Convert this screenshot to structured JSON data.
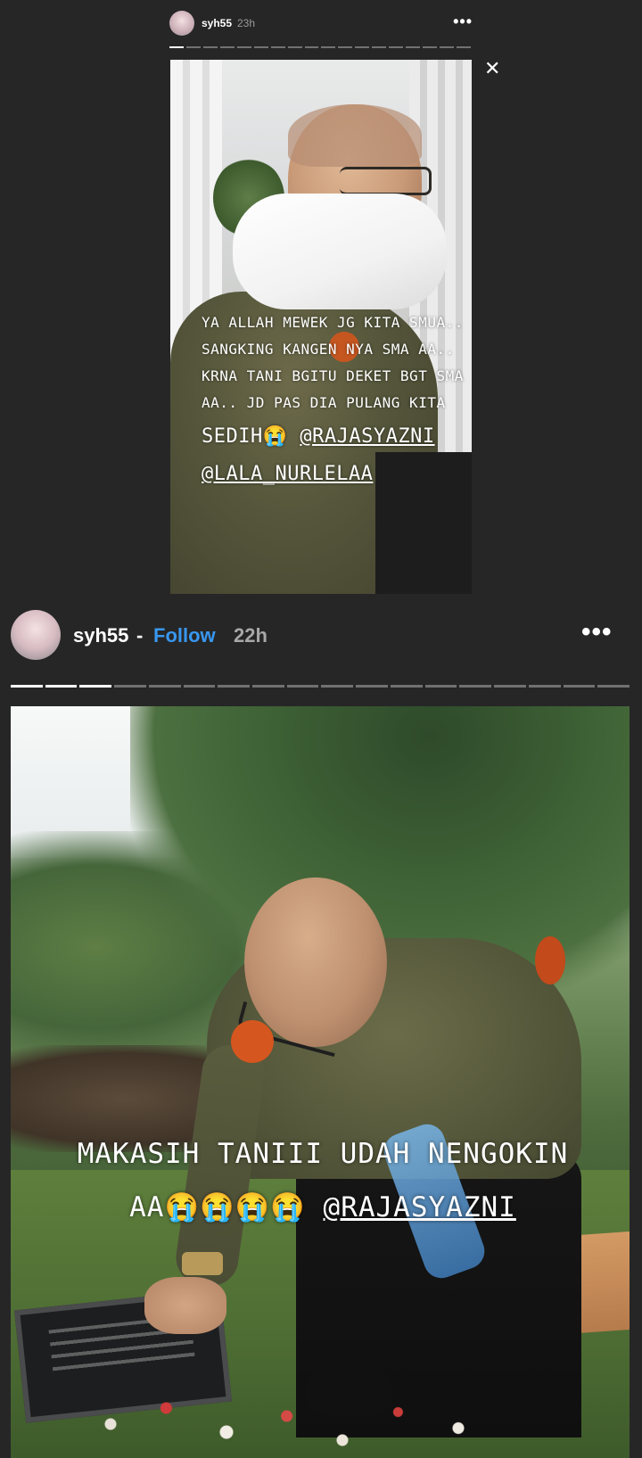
{
  "story_top": {
    "username": "syh55",
    "time": "23h",
    "more": "•••",
    "close": "✕",
    "progress": {
      "segments": 18,
      "completed": 1
    },
    "caption_lines": [
      "YA ALLAH MEWEK JG KITA SMUA..",
      "SANGKING KANGEN NYA SMA AA..",
      "KRNA TANI BGITU DEKET BGT SMA",
      "AA.. JD PAS DIA PULANG KITA"
    ],
    "caption_last": "SEDIH😭 ",
    "mention_1": "@RAJASYAZNI",
    "mention_2": "@LALA_NURLELAA"
  },
  "story_bottom": {
    "username": "syh55",
    "separator": "-",
    "follow": "Follow",
    "time": "22h",
    "more": "•••",
    "progress": {
      "segments": 18,
      "completed": 3
    },
    "caption_line_1": "MAKASIH TANIII UDAH NENGOKIN",
    "caption_line_2_prefix": "AA😭😭😭😭 ",
    "mention": "@RAJASYAZNI"
  },
  "colors": {
    "background": "#262626",
    "follow_link": "#3897f0",
    "time_gray": "#a8a8a8"
  }
}
